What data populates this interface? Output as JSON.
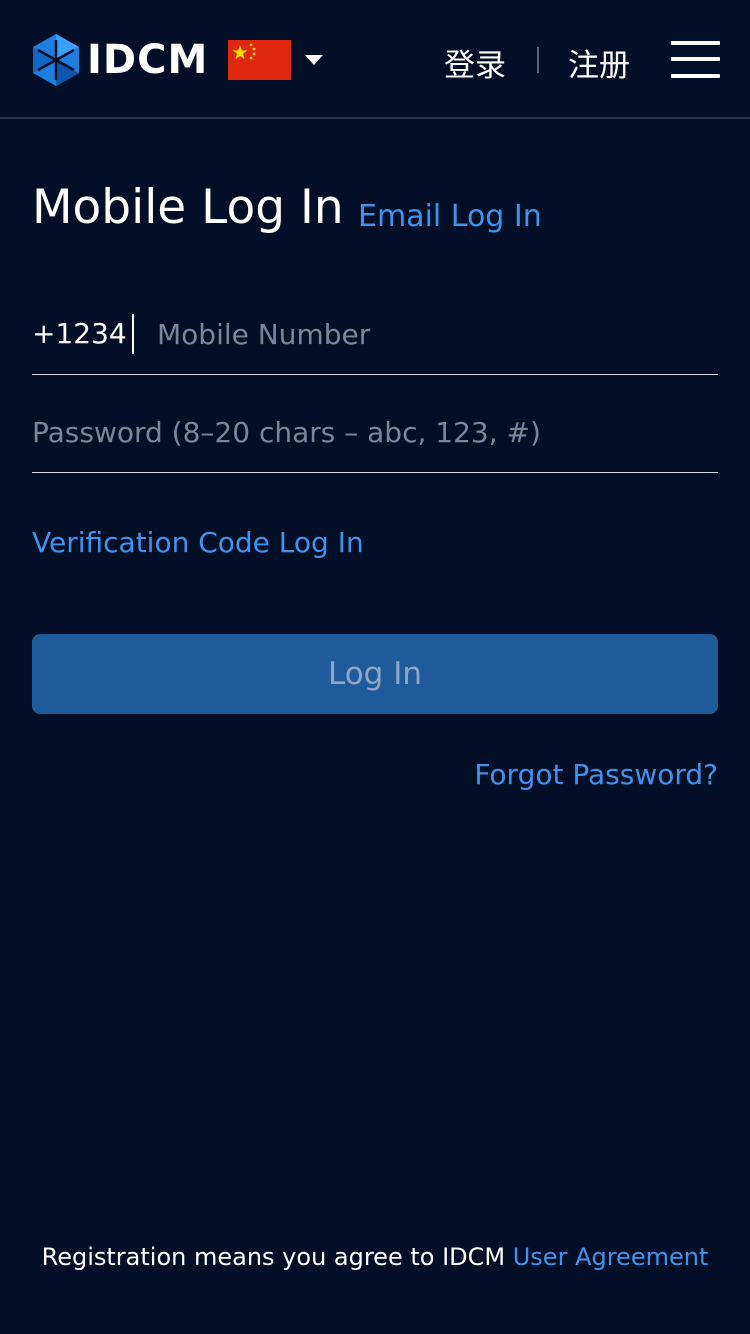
{
  "header": {
    "logo_text": "IDCM",
    "logo_icon": "hexagon-logo-icon",
    "flag": "china-flag",
    "login_label": "登录",
    "register_label": "注册",
    "menu_icon": "hamburger-menu-icon"
  },
  "login": {
    "title": "Mobile Log In",
    "alt_tab": "Email Log In",
    "country_code": "+1234",
    "phone_placeholder": "Mobile Number",
    "password_placeholder": "Password (8–20 chars – abc, 123, #)",
    "verify_link": "Verification Code Log In",
    "submit_label": "Log In",
    "forgot_label": "Forgot Password?"
  },
  "footer": {
    "text": "Registration means you agree to IDCM",
    "agreement_link": "User Agreement"
  },
  "colors": {
    "background": "#020f27",
    "accent": "#3f93ee",
    "button": "#1f5a9b"
  }
}
